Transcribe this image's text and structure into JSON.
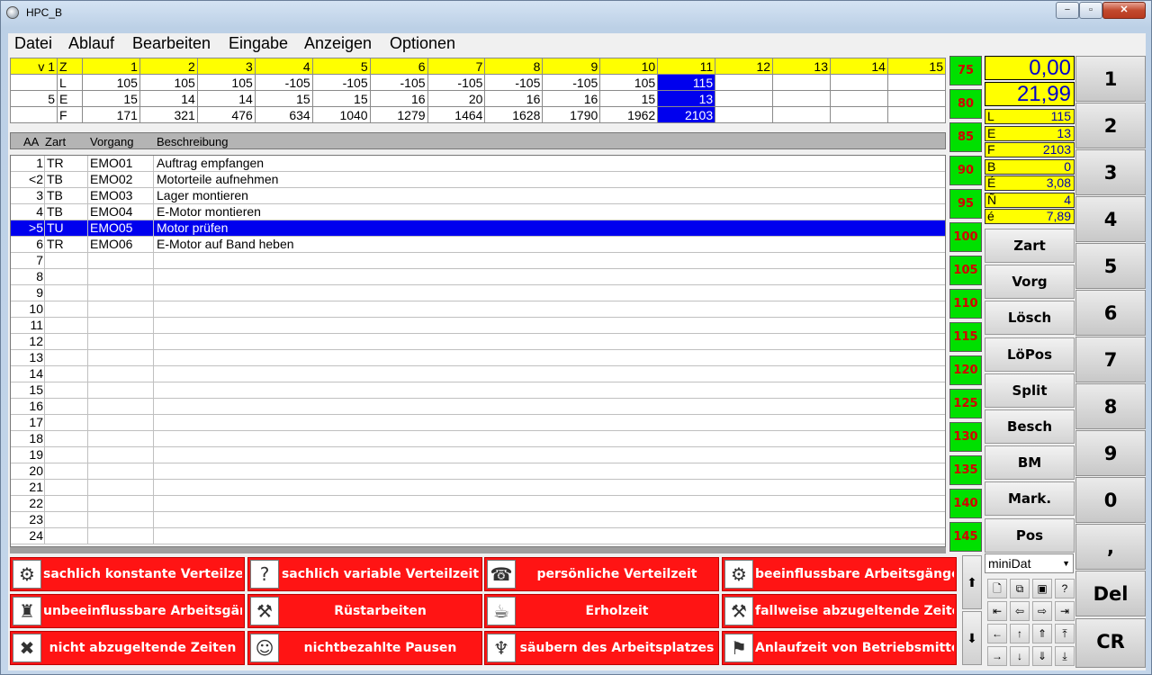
{
  "window": {
    "title": "HPC_B",
    "min": "−",
    "max": "▫",
    "close": "✕"
  },
  "menu": [
    "Datei",
    "Ablauf",
    "Bearbeiten",
    "Eingabe",
    "Anzeigen",
    "Optionen"
  ],
  "stats": {
    "header": [
      "v 1",
      "Z",
      "1",
      "2",
      "3",
      "4",
      "5",
      "6",
      "7",
      "8",
      "9",
      "10",
      "11",
      "12",
      "13",
      "14",
      "15"
    ],
    "rows": [
      [
        "",
        "L",
        "105",
        "105",
        "105",
        "-105",
        "-105",
        "-105",
        "-105",
        "-105",
        "-105",
        "105",
        "115",
        "",
        "",
        "",
        ""
      ],
      [
        "5",
        "E",
        "15",
        "14",
        "14",
        "15",
        "15",
        "16",
        "20",
        "16",
        "16",
        "15",
        "13",
        "",
        "",
        "",
        ""
      ],
      [
        "",
        "F",
        "171",
        "321",
        "476",
        "634",
        "1040",
        "1279",
        "1464",
        "1628",
        "1790",
        "1962",
        "2103",
        "",
        "",
        "",
        ""
      ]
    ]
  },
  "list": {
    "headers": {
      "aa": "AA",
      "zart": "Zart",
      "vorgang": "Vorgang",
      "beschreibung": "Beschreibung"
    },
    "rows": [
      {
        "aa": "1",
        "zart": "TR",
        "vorgang": "EMO01",
        "beschreibung": "Auftrag empfangen"
      },
      {
        "aa": "<2",
        "zart": "TB",
        "vorgang": "EMO02",
        "beschreibung": "Motorteile aufnehmen"
      },
      {
        "aa": "3",
        "zart": "TB",
        "vorgang": "EMO03",
        "beschreibung": "Lager montieren"
      },
      {
        "aa": "4",
        "zart": "TB",
        "vorgang": "EMO04",
        "beschreibung": "E-Motor montieren"
      },
      {
        "aa": ">5",
        "zart": "TU",
        "vorgang": "EMO05",
        "beschreibung": "Motor prüfen"
      },
      {
        "aa": "6",
        "zart": "TR",
        "vorgang": "EMO06",
        "beschreibung": "E-Motor auf Band heben"
      },
      {
        "aa": "7",
        "zart": "",
        "vorgang": "",
        "beschreibung": ""
      },
      {
        "aa": "8",
        "zart": "",
        "vorgang": "",
        "beschreibung": ""
      },
      {
        "aa": "9",
        "zart": "",
        "vorgang": "",
        "beschreibung": ""
      },
      {
        "aa": "10",
        "zart": "",
        "vorgang": "",
        "beschreibung": ""
      },
      {
        "aa": "11",
        "zart": "",
        "vorgang": "",
        "beschreibung": ""
      },
      {
        "aa": "12",
        "zart": "",
        "vorgang": "",
        "beschreibung": ""
      },
      {
        "aa": "13",
        "zart": "",
        "vorgang": "",
        "beschreibung": ""
      },
      {
        "aa": "14",
        "zart": "",
        "vorgang": "",
        "beschreibung": ""
      },
      {
        "aa": "15",
        "zart": "",
        "vorgang": "",
        "beschreibung": ""
      },
      {
        "aa": "16",
        "zart": "",
        "vorgang": "",
        "beschreibung": ""
      },
      {
        "aa": "17",
        "zart": "",
        "vorgang": "",
        "beschreibung": ""
      },
      {
        "aa": "18",
        "zart": "",
        "vorgang": "",
        "beschreibung": ""
      },
      {
        "aa": "19",
        "zart": "",
        "vorgang": "",
        "beschreibung": ""
      },
      {
        "aa": "20",
        "zart": "",
        "vorgang": "",
        "beschreibung": ""
      },
      {
        "aa": "21",
        "zart": "",
        "vorgang": "",
        "beschreibung": ""
      },
      {
        "aa": "22",
        "zart": "",
        "vorgang": "",
        "beschreibung": ""
      },
      {
        "aa": "23",
        "zart": "",
        "vorgang": "",
        "beschreibung": ""
      },
      {
        "aa": "24",
        "zart": "",
        "vorgang": "",
        "beschreibung": ""
      }
    ],
    "selected_index": 4
  },
  "scale": [
    "75",
    "80",
    "85",
    "90",
    "95",
    "100",
    "105",
    "110",
    "115",
    "120",
    "125",
    "130",
    "135",
    "140",
    "145"
  ],
  "values": {
    "top": "0,00",
    "second": "21,99"
  },
  "kv": [
    {
      "k": "L",
      "v": "115"
    },
    {
      "k": "E",
      "v": "13"
    },
    {
      "k": "F",
      "v": "2103"
    },
    {
      "k": "B",
      "v": "0"
    },
    {
      "k": "É",
      "v": "3,08"
    },
    {
      "k": "Ñ",
      "v": "4"
    },
    {
      "k": "é",
      "v": "7,89"
    }
  ],
  "func_buttons": [
    "Zart",
    "Vorg",
    "Lösch",
    "LöPos",
    "Split",
    "Besch",
    "BM",
    "Mark.",
    "Pos"
  ],
  "keypad": [
    "1",
    "2",
    "3",
    "4",
    "5",
    "6",
    "7",
    "8",
    "9",
    "0",
    ",",
    "Del",
    "CR"
  ],
  "dropdown": {
    "value": "miniDat"
  },
  "activities": [
    {
      "label": "sachlich konstante Verteilzeit",
      "icon": "vacuum-icon",
      "glyph": "⚙"
    },
    {
      "label": "sachlich variable Verteilzeit",
      "icon": "question-icon",
      "glyph": "?"
    },
    {
      "label": "persönliche Verteilzeit",
      "icon": "phone-icon",
      "glyph": "☎"
    },
    {
      "label": "beeinflussbare Arbeitsgänge",
      "icon": "gear-icon",
      "glyph": "⚙"
    },
    {
      "label": "unbeeinflussbare Arbeitsgänge",
      "icon": "machine-icon",
      "glyph": "♜"
    },
    {
      "label": "Rüstarbeiten",
      "icon": "worker-icon",
      "glyph": "⚒"
    },
    {
      "label": "Erholzeit",
      "icon": "rest-icon",
      "glyph": "☕"
    },
    {
      "label": "fallweise abzugeltende Zeiten",
      "icon": "worker-tool-icon",
      "glyph": "⚒"
    },
    {
      "label": "nicht abzugeltende Zeiten",
      "icon": "no-entry-icon",
      "glyph": "✖"
    },
    {
      "label": "nichtbezahlte Pausen",
      "icon": "person-icon",
      "glyph": "☺"
    },
    {
      "label": "säubern des Arbeitsplatzes",
      "icon": "broom-icon",
      "glyph": "♆"
    },
    {
      "label": "Anlaufzeit von Betriebsmitteln",
      "icon": "press-icon",
      "glyph": "⚑"
    }
  ],
  "small_icons": [
    {
      "name": "new-file-icon",
      "glyph": "🗋"
    },
    {
      "name": "copy-icon",
      "glyph": "⧉"
    },
    {
      "name": "save-icon",
      "glyph": "▣"
    },
    {
      "name": "help-icon",
      "glyph": "?"
    },
    {
      "name": "first-icon",
      "glyph": "⇤"
    },
    {
      "name": "prev-icon",
      "glyph": "⇦"
    },
    {
      "name": "next-icon",
      "glyph": "⇨"
    },
    {
      "name": "last-icon",
      "glyph": "⇥"
    },
    {
      "name": "left-icon",
      "glyph": "←"
    },
    {
      "name": "up-icon",
      "glyph": "↑"
    },
    {
      "name": "up-top-icon",
      "glyph": "⇑"
    },
    {
      "name": "top-icon",
      "glyph": "⤒"
    },
    {
      "name": "right-icon",
      "glyph": "→"
    },
    {
      "name": "down-icon",
      "glyph": "↓"
    },
    {
      "name": "down-bottom-icon",
      "glyph": "⇓"
    },
    {
      "name": "bottom-icon",
      "glyph": "⤓"
    }
  ],
  "scroll_arrows": {
    "up": "⬆",
    "down": "⬇"
  }
}
